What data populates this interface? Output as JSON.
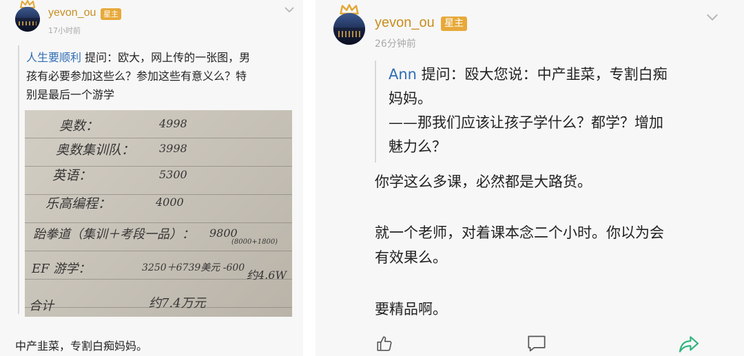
{
  "left_post": {
    "username": "yevon_ou",
    "badge": "星主",
    "time": "17小时前",
    "question_author": "人生要顺利",
    "question_line1": " 提问：欧大，网上传的一张图，男",
    "question_line2": "孩有必要参加这些么？参加这些有意义么？特",
    "question_line3": "别是最后一个游学",
    "photo_note": {
      "rows": [
        {
          "item": "奥数：",
          "price": "4998"
        },
        {
          "item": "奥数集训队：",
          "price": "3998"
        },
        {
          "item": "英语：",
          "price": "5300"
        },
        {
          "item": "乐高编程：",
          "price": "4000"
        },
        {
          "item": "跆拳道（集训＋考段一品）：",
          "price": "9800"
        },
        {
          "item": "EF 游学：",
          "price": "3250＋6739美元 -600"
        },
        {
          "item": "合计",
          "price": "约7.4万元"
        }
      ],
      "aside_sum": "(8000+1800)",
      "aside_total": "约4.6W"
    },
    "answer": "中产韭菜，专割白痴妈妈。"
  },
  "right_post": {
    "username": "yevon_ou",
    "badge": "星主",
    "time": "26分钟前",
    "question_author": "Ann",
    "question_line1": " 提问：殴大您说：中产韭菜，专割白痴",
    "question_line2": "妈妈。",
    "question_line3": "——那我们应该让孩子学什么？都学？增加",
    "question_line4": "魅力么？",
    "answer_p1": "你学这么多课，必然都是大路货。",
    "answer_p2_line1": "就一个老师，对着课本念二个小时。你以为会",
    "answer_p2_line2": "有效果么。",
    "answer_p3": "要精品啊。"
  },
  "icons": {
    "like": "thumbs-up-icon",
    "comment": "comment-icon",
    "share": "share-arrow-icon",
    "menu": "chevron-down-icon",
    "crown": "crown-icon"
  },
  "colors": {
    "username": "#c88e20",
    "badge_bg": "#e7a93a",
    "quote_author": "#2f6db5",
    "share_green": "#2db37a"
  }
}
